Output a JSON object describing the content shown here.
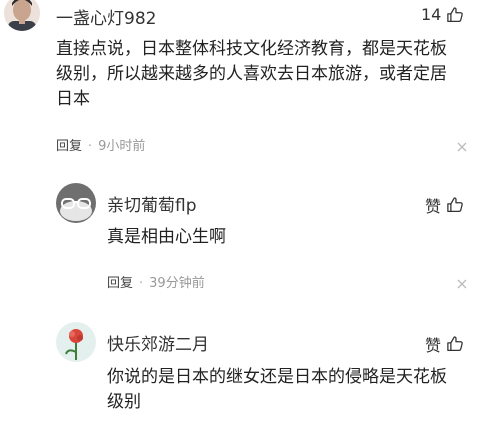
{
  "comments": [
    {
      "username": "一盏心灯982",
      "likes": "14",
      "text_lines": [
        "直接点说，日本整体科技文化经济教育，都是天花板",
        "级别，所以越来越多的人喜欢去日本旅游，或者定居",
        "日本"
      ],
      "reply_label": "回复",
      "separator": "·",
      "time": "9小时前"
    }
  ],
  "replies": [
    {
      "username": "亲切葡萄flp",
      "like_label": "赞",
      "text_lines": [
        "真是相由心生啊"
      ],
      "reply_label": "回复",
      "separator": "·",
      "time": "39分钟前"
    },
    {
      "username": "快乐郊游二月",
      "like_label": "赞",
      "text_lines": [
        "你说的是日本的继女还是日本的侵略是天花板",
        "级别"
      ]
    }
  ],
  "icons": {
    "like": "thumb-up-icon",
    "close": "close-icon"
  }
}
